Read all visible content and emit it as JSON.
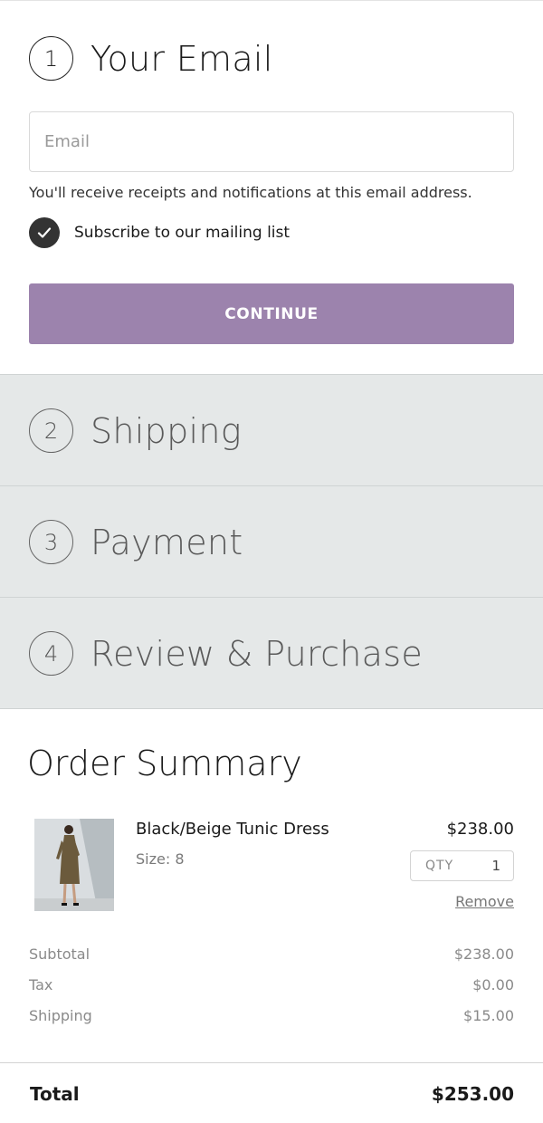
{
  "steps": [
    {
      "number": "1",
      "title": "Your Email"
    },
    {
      "number": "2",
      "title": "Shipping"
    },
    {
      "number": "3",
      "title": "Payment"
    },
    {
      "number": "4",
      "title": "Review & Purchase"
    }
  ],
  "email_step": {
    "email_placeholder": "Email",
    "email_value": "",
    "helper_text": "You'll receive receipts and notifications at this email address.",
    "subscribe_label": "Subscribe to our mailing list",
    "subscribe_checked": true,
    "continue_label": "CONTINUE"
  },
  "colors": {
    "continue_button": "#9c83ad",
    "collapsed_step_bg": "#e5e8e8",
    "checkbox_fill": "#333333"
  },
  "order_summary": {
    "title": "Order Summary",
    "item": {
      "name": "Black/Beige Tunic Dress",
      "size": "Size: 8",
      "price": "$238.00",
      "qty_label": "QTY",
      "qty_value": "1",
      "remove_label": "Remove"
    },
    "lines": [
      {
        "label": "Subtotal",
        "value": "$238.00"
      },
      {
        "label": "Tax",
        "value": "$0.00"
      },
      {
        "label": "Shipping",
        "value": "$15.00"
      }
    ],
    "total": {
      "label": "Total",
      "value": "$253.00"
    }
  }
}
